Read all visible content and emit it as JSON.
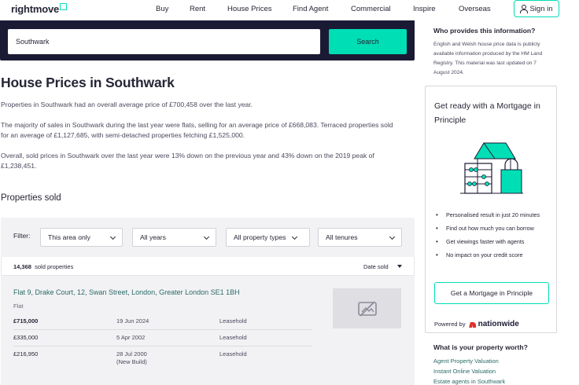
{
  "header": {
    "logo_text": "rightmove",
    "nav": [
      "Buy",
      "Rent",
      "House Prices",
      "Find Agent",
      "Commercial",
      "Inspire",
      "Overseas"
    ],
    "signin_label": "Sign in",
    "accent_color": "#00deb6"
  },
  "search": {
    "value": "Southwark",
    "button_label": "Search",
    "band_color": "#1b1a34"
  },
  "main": {
    "title": "House Prices in Southwark",
    "paragraphs": [
      "Properties in Southwark had an overall average price of £700,458 over the last year.",
      "The majority of sales in Southwark during the last year were flats, selling for an average price of £668,083. Terraced properties sold for an average of £1,127,685, with semi-detached properties fetching £1,525,000.",
      "Overall, sold prices in Southwark over the last year were 13% down on the previous year and 43% down on the 2019 peak of £1,238,451."
    ],
    "section_title": "Properties sold"
  },
  "filters": {
    "label": "Filter:",
    "area": "This area only",
    "years": "All years",
    "property_types": "All property types",
    "tenures": "All tenures"
  },
  "results": {
    "count": "14,368",
    "count_suffix": "sold properties",
    "sort_label": "Date sold"
  },
  "listing": {
    "address": "Flat 9, Drake Court, 12, Swan Street, London, Greater London SE1 1BH",
    "type": "Flat",
    "sales": [
      {
        "price": "£715,000",
        "date": "19 Jun 2024",
        "note": "",
        "tenure": "Leasehold"
      },
      {
        "price": "£335,000",
        "date": "5 Apr 2002",
        "note": "",
        "tenure": "Leasehold"
      },
      {
        "price": "£216,950",
        "date": "28 Jul 2000",
        "note": "(New Build)",
        "tenure": "Leasehold"
      }
    ],
    "thumbnail_icon": "no-image-icon"
  },
  "sidebar": {
    "info_head": "Who provides this information?",
    "info_text": "English and Welsh house price data is publicly available information produced by the HM Land Registry.  This material was last updated on 7 August 2024.",
    "mortgage": {
      "title": "Get ready with a Mortgage in Principle",
      "bullets": [
        "Personalised result in just 20 minutes",
        "Find out how much you can borrow",
        "Get viewings faster with agents",
        "No impact on your credit score"
      ],
      "button_label": "Get a Mortgage in Principle",
      "powered_by": "Powered by",
      "brand": "nationwide"
    },
    "worth_head": "What is your property worth?",
    "worth_links": [
      "Agent Property Valuation",
      "Instant Online Valuation",
      "Estate agents in Southwark"
    ]
  }
}
